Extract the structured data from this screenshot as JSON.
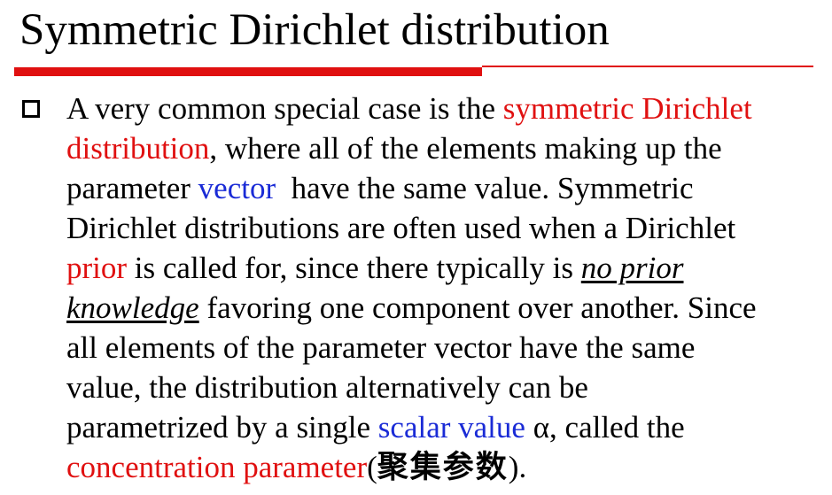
{
  "slide": {
    "title": "Symmetric Dirichlet distribution"
  },
  "accent_color": "#e01010",
  "link_color": "#1a2bd6",
  "bullet": {
    "icon": "hollow-square-bullet-icon",
    "l1a": "A very common special case is the ",
    "l1b": "symmetric Dirichlet",
    "l2a": "distribution",
    "l2b": ", where all of the elements making up the",
    "l3a": "parameter ",
    "l3b": "vector",
    "l3c": "  have the same value. Symmetric",
    "l4": "Dirichlet distributions are often used when a Dirichlet",
    "l5a": "prior",
    "l5b": " is called for, since there typically is ",
    "l5c": "no prior",
    "l6a": "knowledge",
    "l6b": " favoring one component over another. Since",
    "l7": "all elements of the parameter vector have the same",
    "l8": "value, the distribution alternatively can be",
    "l9a": "parametrized by a single ",
    "l9b": "scalar value",
    "l9c": " α, called the",
    "l10a": "concentration parameter",
    "l10b": "(",
    "l10c": "聚集参数",
    "l10d": ")."
  }
}
